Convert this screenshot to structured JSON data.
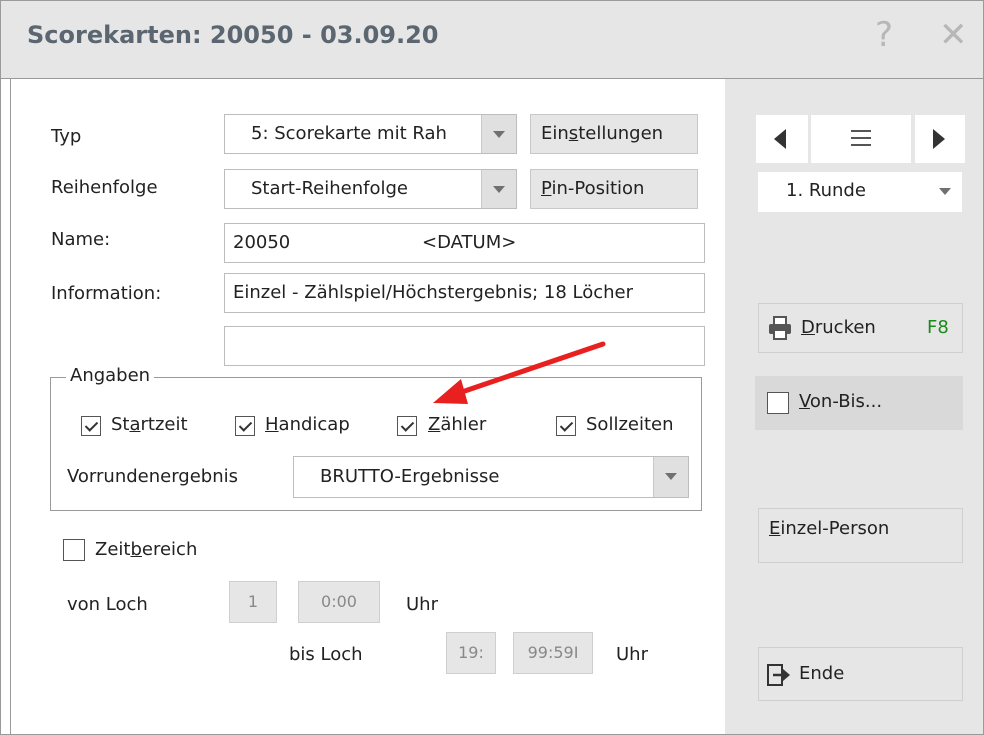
{
  "window": {
    "title": "Scorekarten: 20050 - 03.09.20",
    "help_icon": "?",
    "close_icon": "✕"
  },
  "form": {
    "typ_label": "Typ",
    "typ_value": "5: Scorekarte mit Rah",
    "reihenfolge_label": "Reihenfolge",
    "reihenfolge_value": "Start-Reihenfolge",
    "name_label": "Name:",
    "name_value": "20050",
    "name_date": "<DATUM>",
    "information_label": "Information:",
    "information_value": "Einzel - Zählspiel/Höchstergebnis; 18 Löcher",
    "information_value2": "",
    "einstellungen_prefix": "Ein",
    "einstellungen_underline": "s",
    "einstellungen_suffix": "tellungen",
    "pin_underline": "P",
    "pin_suffix": "in-Position"
  },
  "angaben": {
    "title": "Angaben",
    "startzeit_prefix": "St",
    "startzeit_underline": "a",
    "startzeit_suffix": "rtzeit",
    "startzeit_checked": true,
    "handicap_underline": "H",
    "handicap_suffix": "andicap",
    "handicap_checked": true,
    "zaehler_underline": "Z",
    "zaehler_suffix": "ähler",
    "zaehler_checked": true,
    "sollzeiten_label": "Sollzeiten",
    "sollzeiten_checked": true,
    "vorrunden_label": "Vorrundenergebnis",
    "vorrunden_value": "BRUTTO-Ergebnisse"
  },
  "zeitbereich": {
    "prefix": "Zeit",
    "underline": "b",
    "suffix": "ereich",
    "checked": false,
    "von_loch_label": "von Loch",
    "von_loch_value": "1",
    "von_time": "0:00",
    "uhr1": "Uhr",
    "bis_loch_label": "bis Loch",
    "bis_loch_value": "19:",
    "bis_time": "99:59I",
    "uhr2": "Uhr"
  },
  "side": {
    "runde_value": "1. Runde",
    "drucken_underline": "D",
    "drucken_suffix": "rucken",
    "drucken_shortcut": "F8",
    "vonbis_underline": "V",
    "vonbis_suffix": "on-Bis...",
    "einzel_underline": "E",
    "einzel_suffix": "inzel-Person",
    "ende_label": "Ende"
  },
  "colors": {
    "annotation_arrow": "#e8201f",
    "shortcut": "#1a8a1a"
  }
}
